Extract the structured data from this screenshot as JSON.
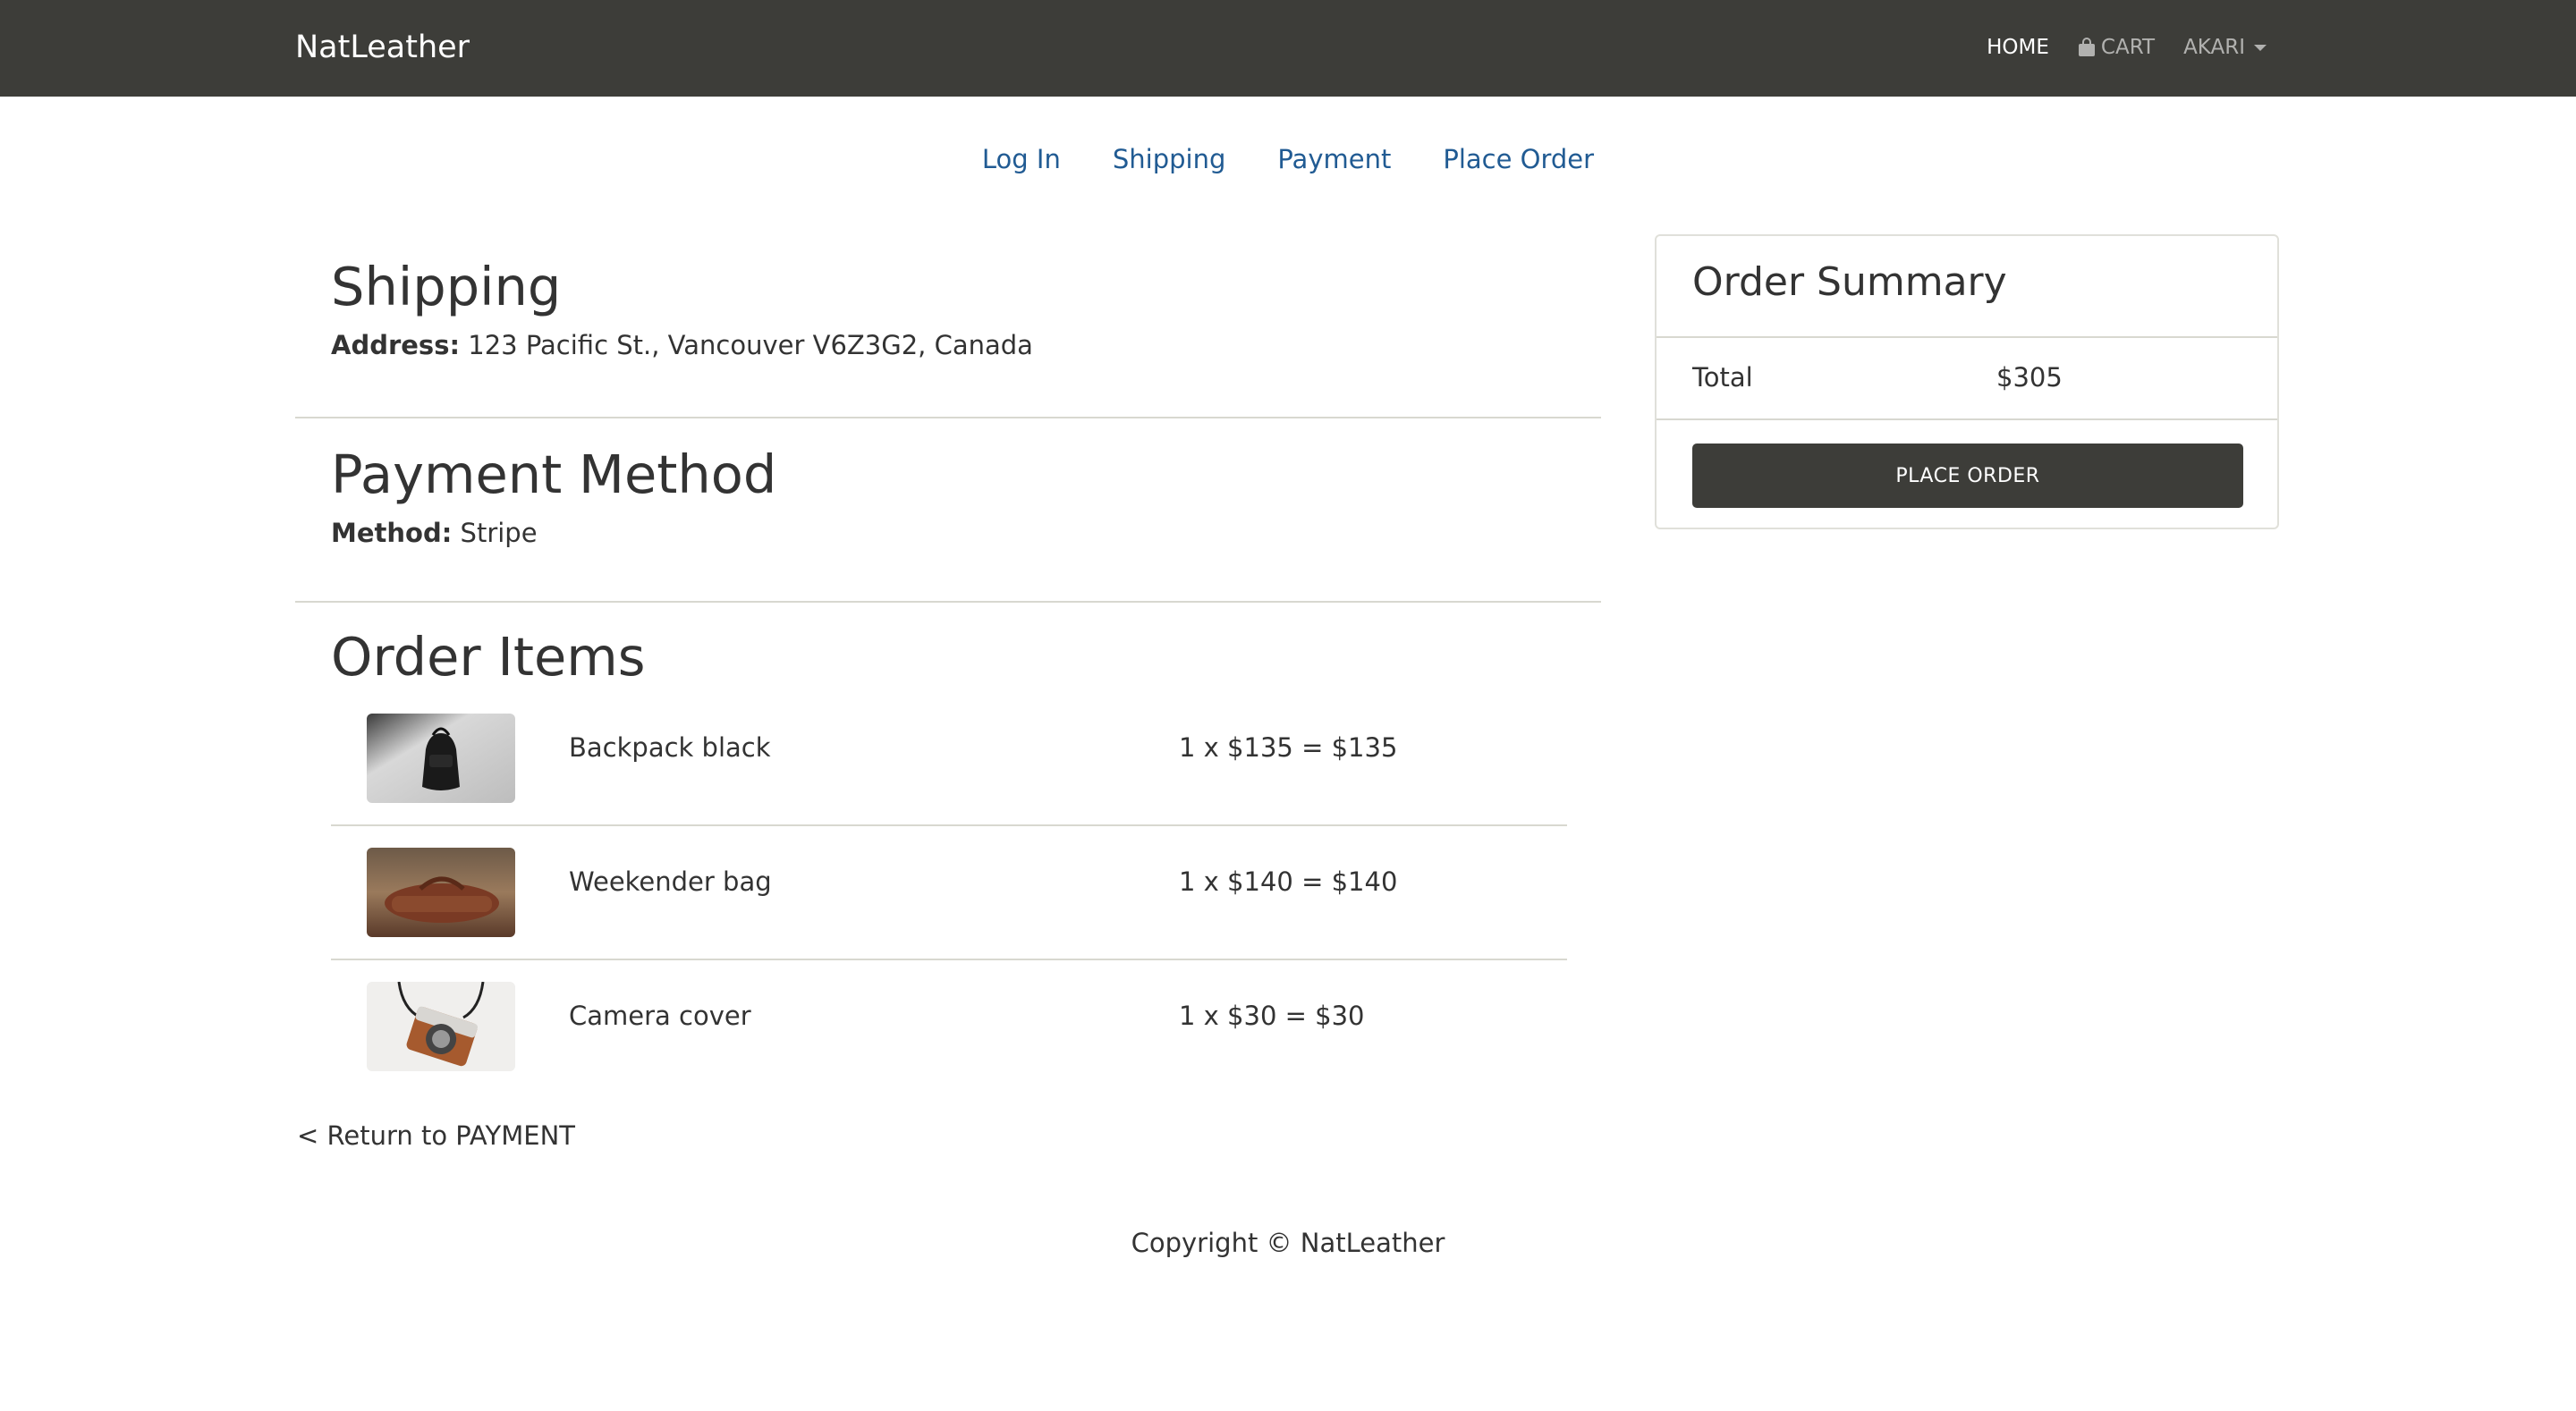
{
  "navbar": {
    "brand": "NatLeather",
    "home": "HOME",
    "cart": "CART",
    "user": "AKARI"
  },
  "steps": [
    "Log In",
    "Shipping",
    "Payment",
    "Place Order"
  ],
  "shipping": {
    "title": "Shipping",
    "address_label": "Address:",
    "address_value": "123 Pacific St., Vancouver V6Z3G2, Canada"
  },
  "payment": {
    "title": "Payment Method",
    "method_label": "Method:",
    "method_value": "Stripe"
  },
  "order_items": {
    "title": "Order Items",
    "items": [
      {
        "name": "Backpack black",
        "calc": "1 x $135 = $135",
        "image": "backpack-black-photo"
      },
      {
        "name": "Weekender bag",
        "calc": "1 x $140 = $140",
        "image": "weekender-bag-photo"
      },
      {
        "name": "Camera cover",
        "calc": "1 x $30 = $30",
        "image": "camera-cover-photo"
      }
    ]
  },
  "return_link": "< Return to PAYMENT",
  "summary": {
    "title": "Order Summary",
    "total_label": "Total",
    "total_value": "$305",
    "button": "PLACE ORDER"
  },
  "footer": "Copyright © NatLeather",
  "colors": {
    "navbar": "#3d3d39",
    "step_link": "#215b93",
    "button": "#3d3d39"
  }
}
